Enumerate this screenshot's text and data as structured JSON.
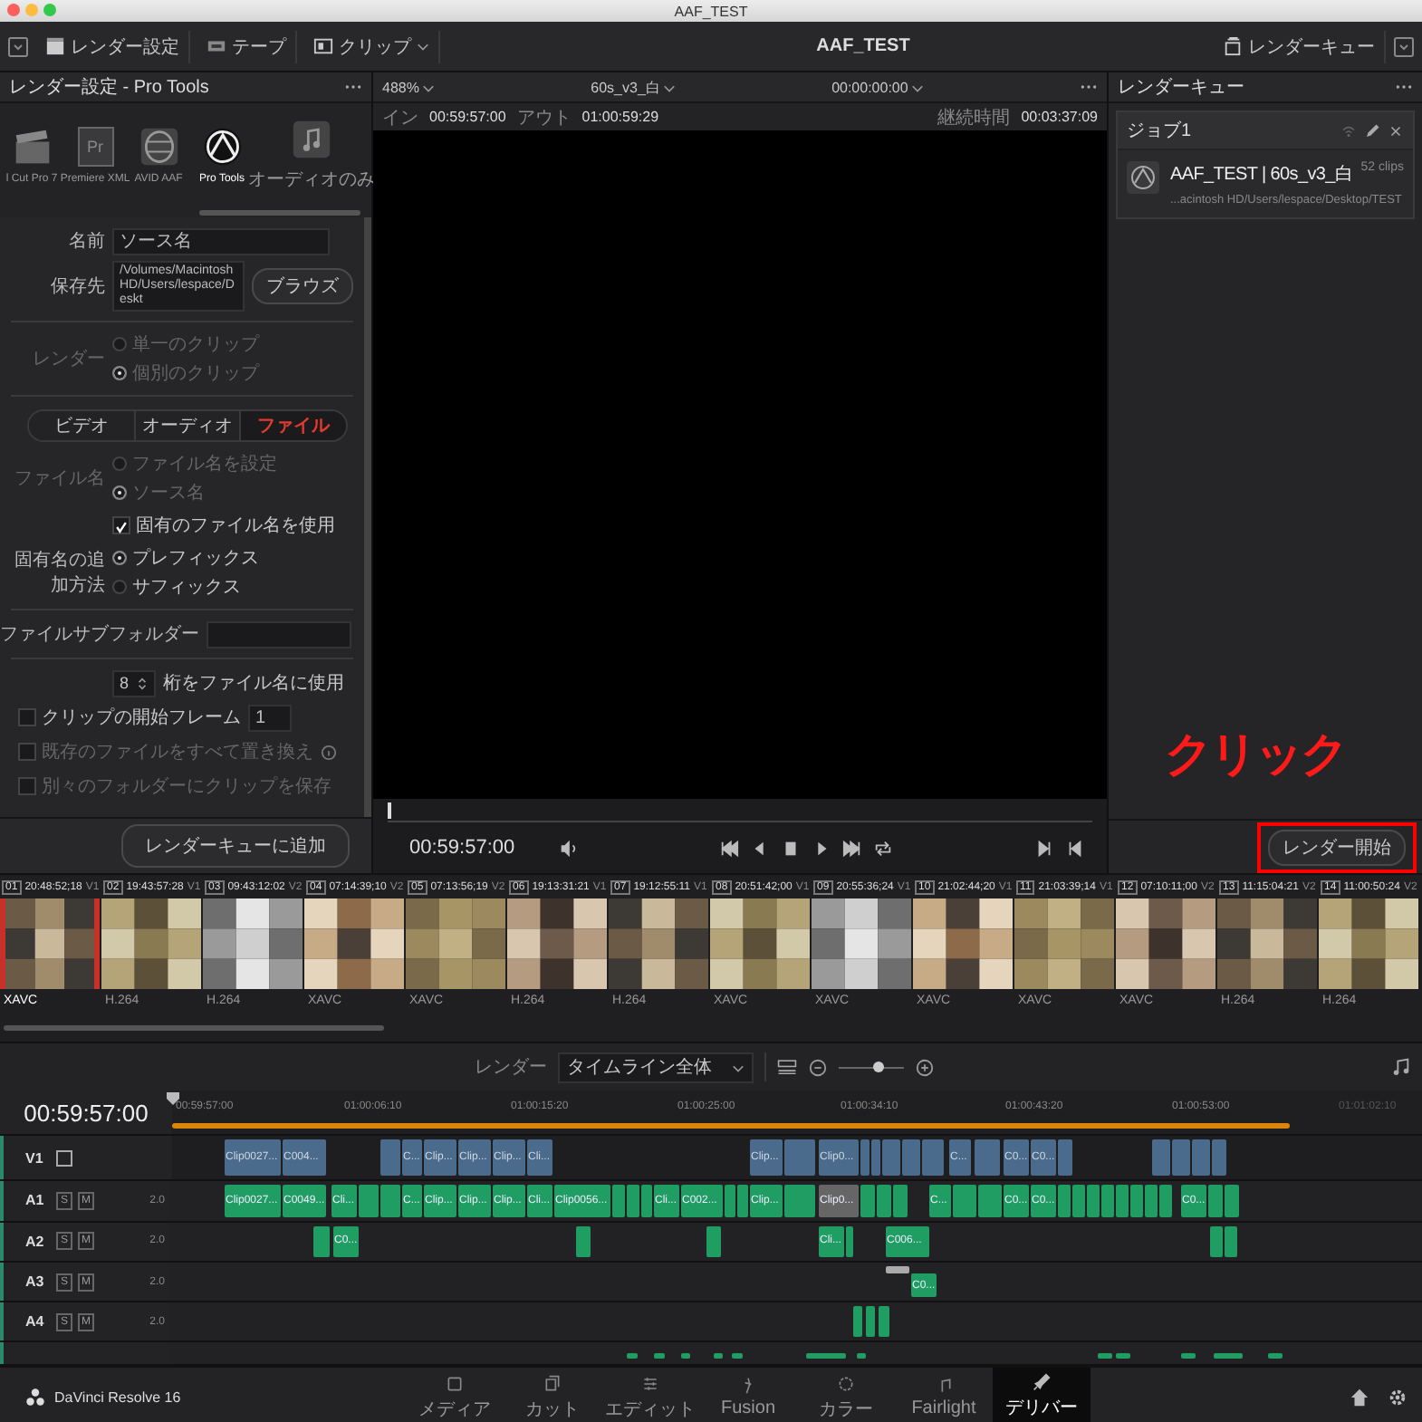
{
  "window": {
    "title": "AAF_TEST"
  },
  "toolbar": {
    "buttons": [
      "レンダー設定",
      "テープ",
      "クリップ"
    ],
    "project": "AAF_TEST",
    "queue_button": "レンダーキュー"
  },
  "render_settings": {
    "title": "レンダー設定 - Pro Tools",
    "formats": [
      {
        "label": "l Cut Pro 7",
        "selected": false
      },
      {
        "label": "Premiere XML",
        "badge": "Pr",
        "selected": false
      },
      {
        "label": "AVID AAF",
        "selected": false
      },
      {
        "label": "Pro Tools",
        "selected": true
      },
      {
        "label": "オーディオのみ",
        "selected": false
      }
    ],
    "name_field": {
      "label": "名前",
      "value": "ソース名"
    },
    "location_field": {
      "label": "保存先",
      "value": "/Volumes/Macintosh HD/Users/lespace/Deskt"
    },
    "browse_button": "ブラウズ",
    "render_mode": {
      "label": "レンダー",
      "disabled": true,
      "options": [
        {
          "label": "単一のクリップ",
          "selected": false
        },
        {
          "label": "個別のクリップ",
          "selected": true
        }
      ]
    },
    "tabs": [
      {
        "label": "ビデオ",
        "selected": false
      },
      {
        "label": "オーディオ",
        "selected": false
      },
      {
        "label": "ファイル",
        "selected": true
      }
    ],
    "filename": {
      "label": "ファイル名",
      "disabled": true,
      "options": [
        {
          "label": "ファイル名を設定",
          "selected": false
        },
        {
          "label": "ソース名",
          "selected": true
        }
      ]
    },
    "unique_name": {
      "label": "固有のファイル名を使用",
      "checked": true
    },
    "unique_method": {
      "label": "固有名の追加方法",
      "options": [
        {
          "label": "プレフィックス",
          "selected": true
        },
        {
          "label": "サフィックス",
          "selected": false
        }
      ]
    },
    "subfolder": {
      "label": "ファイルサブフォルダー"
    },
    "digits": {
      "value": "8",
      "label": "桁をファイル名に使用"
    },
    "checks": [
      {
        "label": "クリップの開始フレーム",
        "checked": false,
        "disabled": false,
        "value": "1"
      },
      {
        "label": "既存のファイルをすべて置き換え",
        "checked": false,
        "disabled": true,
        "info": true
      },
      {
        "label": "別々のフォルダーにクリップを保存",
        "checked": false,
        "disabled": true
      }
    ],
    "add_button": "レンダーキューに追加"
  },
  "viewer": {
    "zoom": "488%",
    "timeline": "60s_v3_白",
    "timecode": "00:00:00:00",
    "in_label": "イン",
    "in": "00:59:57:00",
    "out_label": "アウト",
    "out": "01:00:59:29",
    "duration_label": "継続時間",
    "duration": "00:03:37:09",
    "current": "00:59:57:00",
    "scrub": {
      "level": 0
    }
  },
  "queue": {
    "title": "レンダーキュー",
    "jobs": [
      {
        "title": "ジョブ1",
        "name": "AAF_TEST | 60s_v3_白",
        "count": "52 clips",
        "path": "...acintosh HD/Users/lespace/Desktop/TEST"
      }
    ],
    "start_button": "レンダー開始"
  },
  "annotation": {
    "text": "クリック"
  },
  "clips": [
    {
      "number": "01",
      "timecode": "20:48:52;18",
      "track": "V1",
      "codec": "XAVC",
      "selected": true
    },
    {
      "number": "02",
      "timecode": "19:43:57:28",
      "track": "V1",
      "codec": "H.264",
      "selected": false
    },
    {
      "number": "03",
      "timecode": "09:43:12:02",
      "track": "V2",
      "codec": "H.264",
      "selected": false
    },
    {
      "number": "04",
      "timecode": "07:14:39;10",
      "track": "V2",
      "codec": "XAVC",
      "selected": false
    },
    {
      "number": "05",
      "timecode": "07:13:56;19",
      "track": "V2",
      "codec": "XAVC",
      "selected": false
    },
    {
      "number": "06",
      "timecode": "19:13:31:21",
      "track": "V1",
      "codec": "H.264",
      "selected": false
    },
    {
      "number": "07",
      "timecode": "19:12:55:11",
      "track": "V1",
      "codec": "H.264",
      "selected": false
    },
    {
      "number": "08",
      "timecode": "20:51:42;00",
      "track": "V1",
      "codec": "XAVC",
      "selected": false
    },
    {
      "number": "09",
      "timecode": "20:55:36;24",
      "track": "V1",
      "codec": "XAVC",
      "selected": false
    },
    {
      "number": "10",
      "timecode": "21:02:44;20",
      "track": "V1",
      "codec": "XAVC",
      "selected": false
    },
    {
      "number": "11",
      "timecode": "21:03:39;14",
      "track": "V1",
      "codec": "XAVC",
      "selected": false
    },
    {
      "number": "12",
      "timecode": "07:10:11;00",
      "track": "V2",
      "codec": "XAVC",
      "selected": false
    },
    {
      "number": "13",
      "timecode": "11:15:04:21",
      "track": "V2",
      "codec": "H.264",
      "selected": false
    },
    {
      "number": "14",
      "timecode": "11:00:50:24",
      "track": "V2",
      "codec": "H.264",
      "selected": false
    }
  ],
  "timeline_bar": {
    "render_label": "レンダー",
    "render_value": "タイムライン全体",
    "zoom": {
      "level": 0.6
    }
  },
  "timeline": {
    "timecode": "00:59:57:00",
    "ticks": [
      "00:59:57:00",
      "01:00:06:10",
      "01:00:15:20",
      "01:00:25:00",
      "01:00:34:10",
      "01:00:43:20",
      "01:00:53:00",
      "01:01:02:10"
    ],
    "tracks": [
      {
        "name": "V1",
        "kind": "video",
        "clips": [
          {
            "label": "Clip0027..."
          },
          {
            "label": "C004..."
          },
          {
            "label": "C..."
          },
          {
            "label": "Clip..."
          },
          {
            "label": "Clip..."
          },
          {
            "label": "Clip..."
          },
          {
            "label": "Cli..."
          },
          {
            "label": "Clip..."
          },
          {
            "label": "Clip0..."
          },
          {
            "label": "C..."
          },
          {
            "label": "C0..."
          },
          {
            "label": "C0..."
          }
        ]
      },
      {
        "name": "A1",
        "kind": "audio",
        "solo": "S",
        "mute": "M",
        "volume": "2.0",
        "clips": [
          {
            "label": "Clip0027...",
            "color": "#1f9d63"
          },
          {
            "label": "C0049...",
            "color": "#1f9d63"
          },
          {
            "label": "Cli...",
            "color": "#1f9d63"
          },
          {
            "label": "C...",
            "color": "#1f9d63"
          },
          {
            "label": "Clip...",
            "color": "#1f9d63"
          },
          {
            "label": "Clip...",
            "color": "#1f9d63"
          },
          {
            "label": "Clip...",
            "color": "#1f9d63"
          },
          {
            "label": "Cli...",
            "color": "#1f9d63"
          },
          {
            "label": "Clip0056...",
            "color": "#1f9d63"
          },
          {
            "label": "Cli...",
            "color": "#1f9d63"
          },
          {
            "label": "C002...",
            "color": "#1f9d63"
          },
          {
            "label": "Clip...",
            "color": "#1f9d63"
          },
          {
            "label": "Clip0...",
            "color": "#666666"
          },
          {
            "label": "C...",
            "color": "#1f9d63"
          },
          {
            "label": "C0...",
            "color": "#1f9d63"
          },
          {
            "label": "C0...",
            "color": "#1f9d63"
          },
          {
            "label": "C0...",
            "color": "#1f9d63"
          }
        ]
      },
      {
        "name": "A2",
        "kind": "audio",
        "solo": "S",
        "mute": "M",
        "volume": "2.0",
        "clips": [
          {
            "label": "C0...",
            "color": "#1f9d63"
          },
          {
            "label": "Cli...",
            "color": "#1f9d63"
          },
          {
            "label": "C006...",
            "color": "#1f9d63"
          }
        ]
      },
      {
        "name": "A3",
        "kind": "audio",
        "solo": "S",
        "mute": "M",
        "volume": "2.0",
        "clips": [
          {
            "label": "C0...",
            "color": "#1f9d63"
          }
        ]
      },
      {
        "name": "A4",
        "kind": "audio",
        "solo": "S",
        "mute": "M",
        "volume": "2.0"
      }
    ]
  },
  "app_name": "DaVinci Resolve 16",
  "pages": [
    {
      "label": "メディア",
      "selected": false
    },
    {
      "label": "カット",
      "selected": false
    },
    {
      "label": "エディット",
      "selected": false
    },
    {
      "label": "Fusion",
      "selected": false
    },
    {
      "label": "カラー",
      "selected": false
    },
    {
      "label": "Fairlight",
      "selected": false
    },
    {
      "label": "デリバー",
      "selected": true
    }
  ]
}
